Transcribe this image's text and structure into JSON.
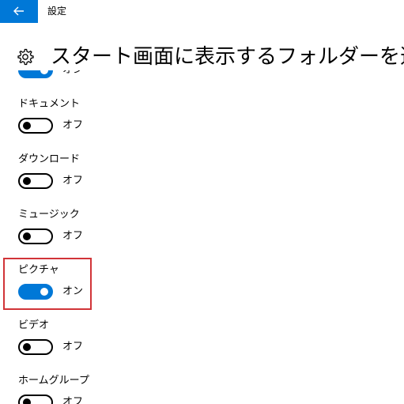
{
  "titlebar": {
    "app_title": "設定",
    "back_icon": "back-arrow-icon"
  },
  "header": {
    "icon": "gear-icon",
    "title": "スタート画面に表示するフォルダーを選ぶ"
  },
  "settings": {
    "partial": {
      "state": "オン",
      "on": true
    },
    "items": [
      {
        "label": "ドキュメント",
        "state": "オフ",
        "on": false
      },
      {
        "label": "ダウンロード",
        "state": "オフ",
        "on": false
      },
      {
        "label": "ミュージック",
        "state": "オフ",
        "on": false
      },
      {
        "label": "ピクチャ",
        "state": "オン",
        "on": true
      },
      {
        "label": "ビデオ",
        "state": "オフ",
        "on": false
      },
      {
        "label": "ホームグループ",
        "state": "オフ",
        "on": false
      }
    ]
  },
  "colors": {
    "accent": "#0078d7",
    "highlight": "#d13438"
  }
}
